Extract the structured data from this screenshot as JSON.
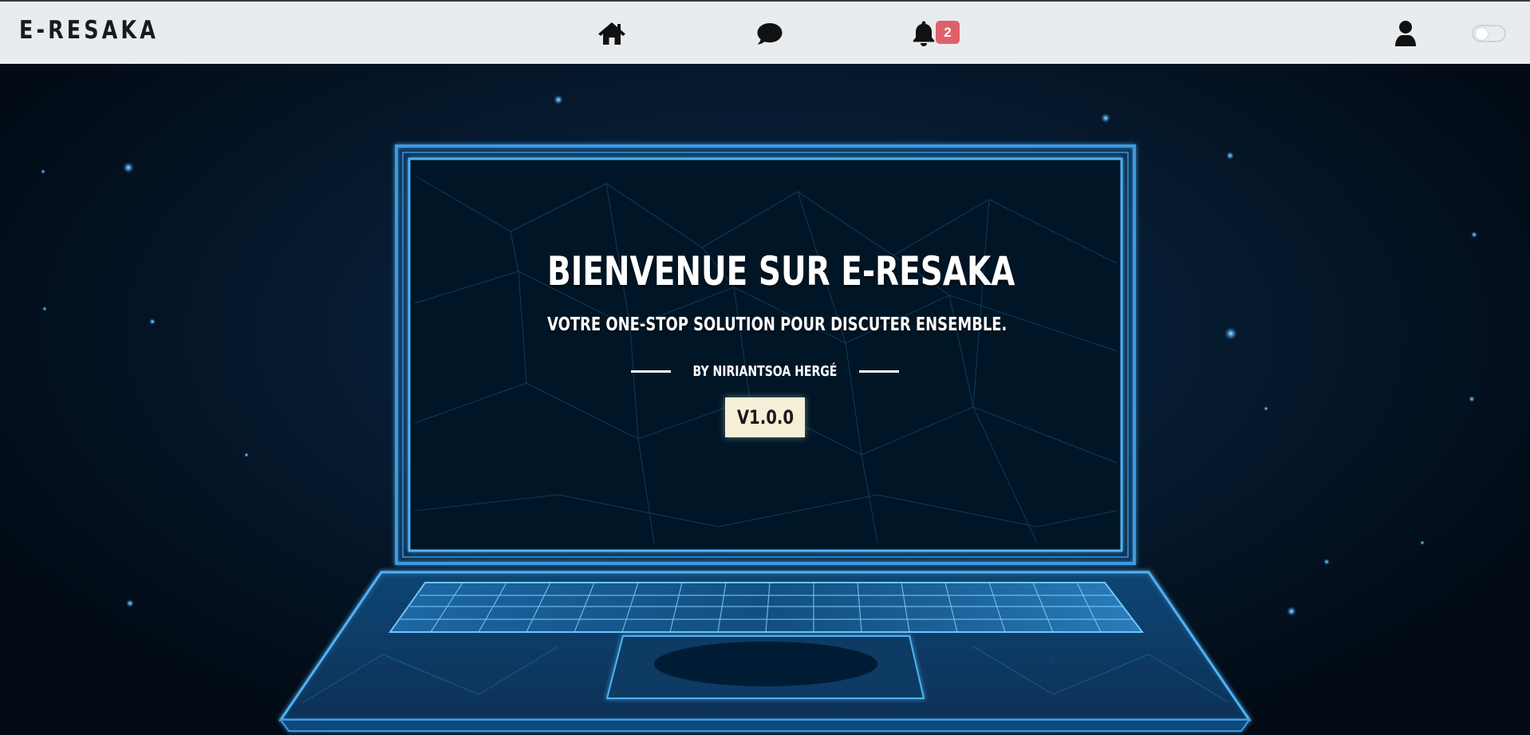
{
  "navbar": {
    "brand": "E-RESAKA",
    "icons": {
      "home": "home-icon",
      "messages": "chat-icon",
      "notifications": "bell-icon",
      "profile": "user-icon"
    },
    "notification_count": "2",
    "theme_toggle_on": false
  },
  "hero": {
    "title": "BIENVENUE SUR E-RESAKA",
    "subtitle": "VOTRE ONE-STOP SOLUTION POUR DISCUTER ENSEMBLE.",
    "author": "BY NIRIANTSOA HERGÉ",
    "version": "V1.0.0"
  },
  "colors": {
    "navbar_bg": "#e9ecef",
    "badge_bg": "#e0606a",
    "hero_bg": "#061b31",
    "laptop_glow": "#3ea8f0",
    "version_bg": "#f6efd8"
  }
}
